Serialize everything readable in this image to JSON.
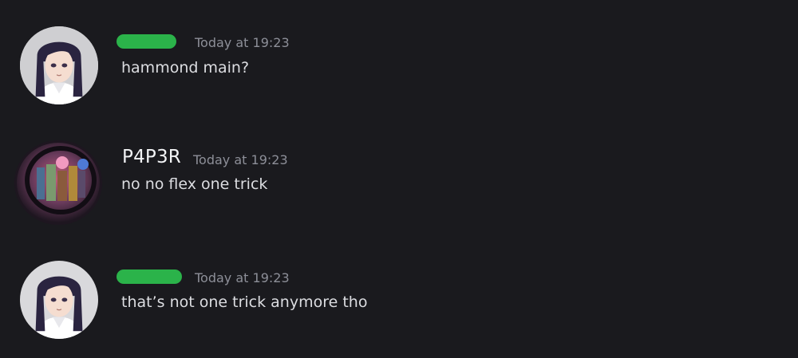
{
  "messages": [
    {
      "author": "",
      "author_redacted": true,
      "avatar": "anime-girl-avatar",
      "timestamp": "Today at 19:23",
      "text": "hammond main?"
    },
    {
      "author": "P4P3R",
      "author_redacted": false,
      "avatar": "game-characters-avatar",
      "timestamp": "Today at 19:23",
      "text": "no no flex one trick"
    },
    {
      "author": "",
      "author_redacted": true,
      "avatar": "anime-girl-avatar",
      "timestamp": "Today at 19:23",
      "text": "that’s not one trick anymore tho"
    }
  ],
  "colors": {
    "background": "#1a1a1e",
    "redaction": "#2bb34a",
    "timestamp": "#8d8f98",
    "text": "#dcdde1"
  }
}
